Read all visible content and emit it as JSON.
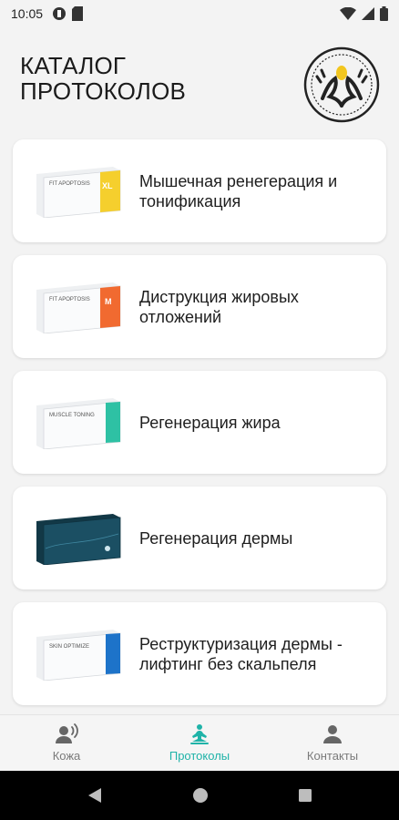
{
  "status_bar": {
    "time": "10:05"
  },
  "header": {
    "title": "КАТАЛОГ\nПРОТОКОЛОВ"
  },
  "protocols": [
    {
      "title": "Мышечная ренегерация и тонификация",
      "box_label": "FIT APOPTOSIS",
      "box_badge": "XL",
      "accent": "#f5cf2d"
    },
    {
      "title": "Диструкция жировых отложений",
      "box_label": "FIT APOPTOSIS",
      "box_badge": "M",
      "accent": "#f16a30"
    },
    {
      "title": "Регенерация жира",
      "box_label": "MUSCLE TONING",
      "box_badge": "",
      "accent": "#2ec1a4"
    },
    {
      "title": "Регенерация дермы",
      "box_label": "",
      "box_badge": "",
      "accent": "#1b4f63"
    },
    {
      "title": "Реструктуризация дермы - лифтинг без скальпеля",
      "box_label": "SKIN OPTIMIZE",
      "box_badge": "",
      "accent": "#1d73c9"
    }
  ],
  "bottom_nav": [
    {
      "label": "Кожа",
      "icon": "person-voice-icon",
      "active": false
    },
    {
      "label": "Протоколы",
      "icon": "meditation-icon",
      "active": true
    },
    {
      "label": "Контакты",
      "icon": "person-icon",
      "active": false
    }
  ],
  "colors": {
    "accent": "#1fb3a8",
    "background": "#f3f3f3"
  }
}
